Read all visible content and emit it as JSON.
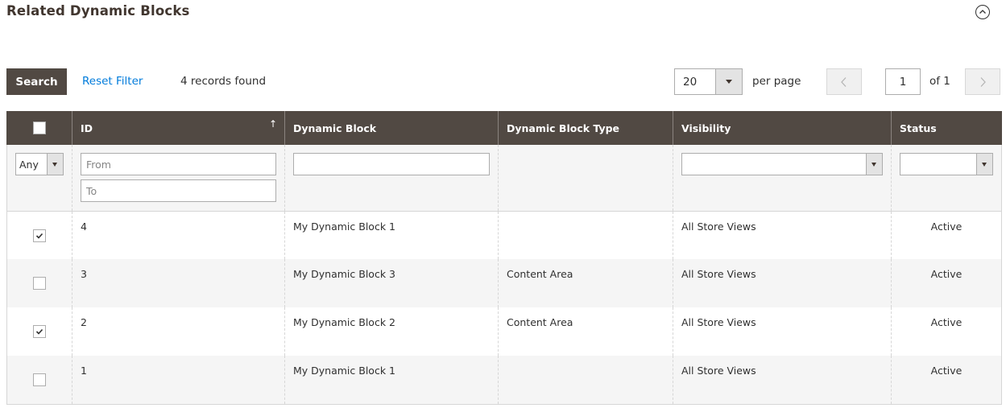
{
  "section": {
    "title": "Related Dynamic Blocks",
    "collapse_icon": "chevron-up-circle-icon"
  },
  "toolbar": {
    "search_label": "Search",
    "reset_label": "Reset Filter",
    "records_found": "4 records found",
    "per_page_value": "20",
    "per_page_label": "per page",
    "current_page": "1",
    "page_of": "of 1"
  },
  "grid": {
    "columns": [
      "ID",
      "Dynamic Block",
      "Dynamic Block Type",
      "Visibility",
      "Status"
    ],
    "sorted_column": "ID",
    "filters": {
      "mass_select": "Any",
      "id_from_placeholder": "From",
      "id_to_placeholder": "To",
      "dynamic_block_value": "",
      "visibility_value": "",
      "status_value": ""
    },
    "rows": [
      {
        "checked": true,
        "id": "4",
        "name": "My Dynamic Block 1",
        "type": "",
        "visibility": "All Store Views",
        "status": "Active"
      },
      {
        "checked": false,
        "id": "3",
        "name": "My Dynamic Block 3",
        "type": "Content Area",
        "visibility": "All Store Views",
        "status": "Active"
      },
      {
        "checked": true,
        "id": "2",
        "name": "My Dynamic Block 2",
        "type": "Content Area",
        "visibility": "All Store Views",
        "status": "Active"
      },
      {
        "checked": false,
        "id": "1",
        "name": "My Dynamic Block 1",
        "type": "",
        "visibility": "All Store Views",
        "status": "Active"
      }
    ]
  },
  "colors": {
    "header_bg": "#514943",
    "link": "#007bdb",
    "stripe": "#f5f5f5"
  }
}
